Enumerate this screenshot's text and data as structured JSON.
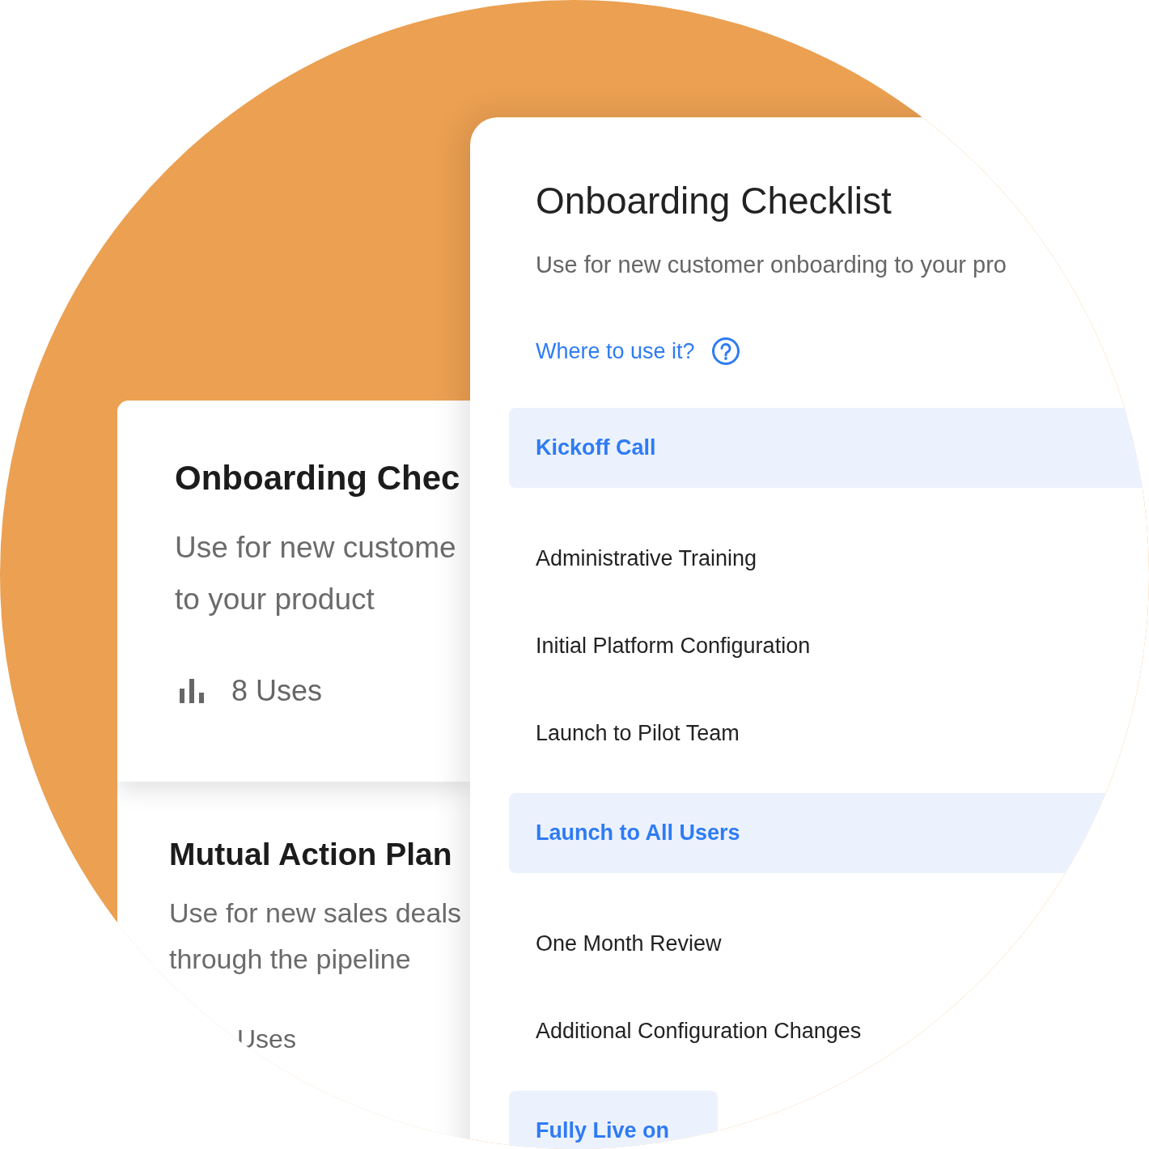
{
  "template_cards": [
    {
      "title": "Onboarding Chec",
      "description_lines": [
        "Use for new custome",
        "to your product"
      ],
      "uses": "8 Uses"
    },
    {
      "title": "Mutual Action Plan",
      "description_lines": [
        "Use for new sales deals",
        "through the pipeline"
      ],
      "uses": "Uses"
    }
  ],
  "detail": {
    "title": "Onboarding Checklist",
    "description": "Use for new customer onboarding to your pro",
    "help_link": "Where to use it?",
    "sections": [
      {
        "title": "Kickoff Call",
        "tasks": [
          "Administrative Training",
          "Initial Platform Configuration",
          "Launch to Pilot Team"
        ]
      },
      {
        "title": "Launch to All Users",
        "tasks": [
          "One Month Review",
          "Additional Configuration Changes"
        ]
      },
      {
        "title": "Fully Live on"
      }
    ]
  }
}
